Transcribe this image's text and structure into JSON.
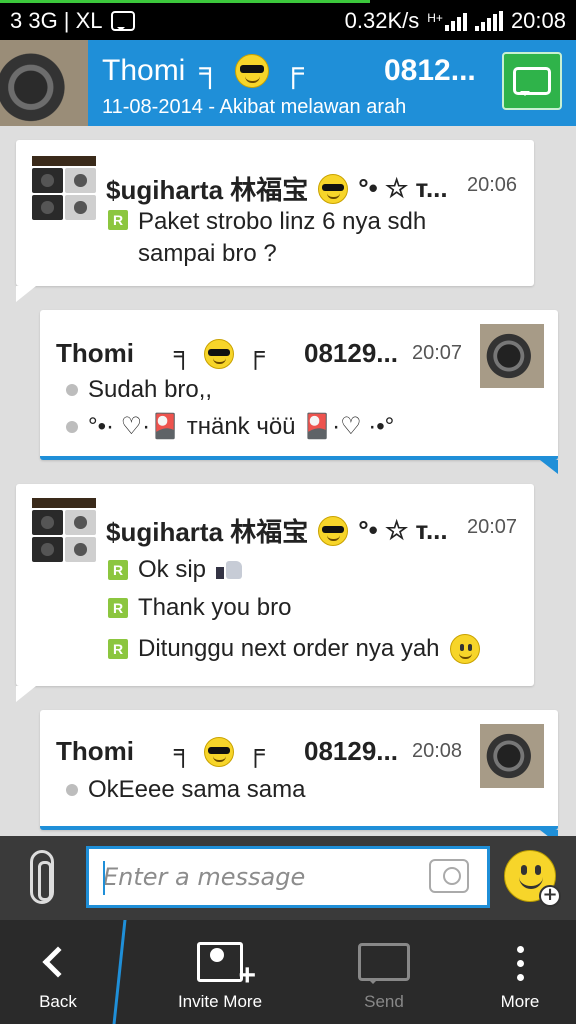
{
  "status_bar": {
    "carrier": "3 3G | XL",
    "speed": "0.32K/s",
    "network_badge": "H+",
    "time": "20:08"
  },
  "header": {
    "contact_name": "Thomi",
    "name_left_mark": "╕",
    "name_right_mark": "╒",
    "phone": "0812...",
    "status_message": "11-08-2014 - Akibat melawan arah",
    "call_icon": "phone-bubble-icon"
  },
  "messages": [
    {
      "direction": "incoming",
      "sender": "$ugiharta 林福宝",
      "sender_suffix": "°• ☆ т...",
      "time": "20:06",
      "lines": [
        "Paket strobo linz 6 nya sdh sampai bro ?"
      ]
    },
    {
      "direction": "outgoing",
      "sender": "Thomi",
      "name_left_mark": "╕",
      "name_right_mark": "╒",
      "phone": "08129...",
      "time": "20:07",
      "lines": [
        "Sudah bro,,",
        "°•· ♡·🎴 тнänk чöü 🎴·♡ ·•°"
      ]
    },
    {
      "direction": "incoming",
      "sender": "$ugiharta 林福宝",
      "sender_suffix": "°• ☆ т...",
      "time": "20:07",
      "lines": [
        "Ok sip",
        "Thank you bro",
        "Ditunggu next order nya yah"
      ]
    },
    {
      "direction": "outgoing",
      "sender": "Thomi",
      "name_left_mark": "╕",
      "name_right_mark": "╒",
      "phone": "08129...",
      "time": "20:08",
      "lines": [
        "OkEeee sama sama"
      ]
    }
  ],
  "compose": {
    "placeholder": "Enter a message",
    "value": ""
  },
  "action_bar": {
    "back": "Back",
    "invite_more": "Invite More",
    "send": "Send",
    "more": "More"
  },
  "colors": {
    "header_blue": "#1f8fd8",
    "call_green": "#2fb34a",
    "read_badge_green": "#8cc63f"
  },
  "read_badge": "R"
}
